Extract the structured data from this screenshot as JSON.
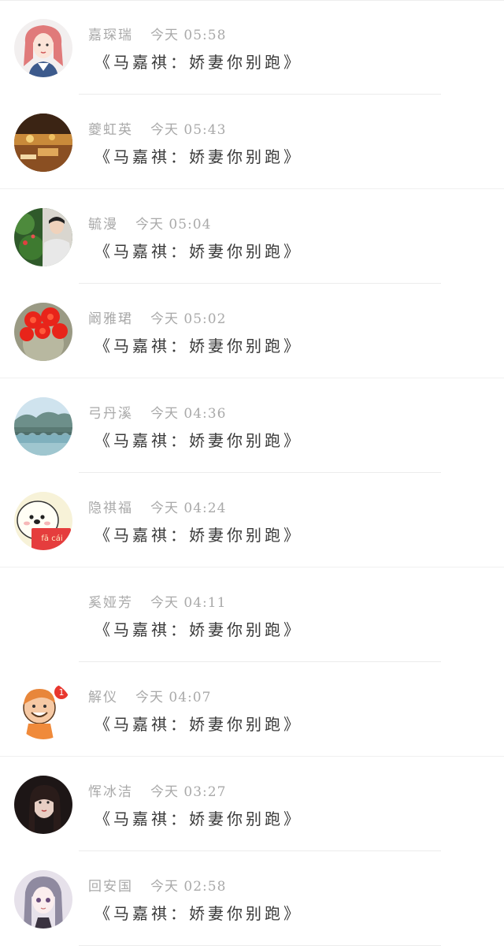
{
  "messages": [
    {
      "name": "嘉琛瑞",
      "time": "今天 05:58",
      "text": "《马嘉祺：娇妻你别跑》",
      "avatar": "girl-red-hair-avatar"
    },
    {
      "name": "夔虹英",
      "time": "今天 05:43",
      "text": "《马嘉祺：娇妻你别跑》",
      "avatar": "warm-street-photo-avatar"
    },
    {
      "name": "毓漫",
      "time": "今天 05:04",
      "text": "《马嘉祺：娇妻你别跑》",
      "avatar": "man-in-garden-avatar"
    },
    {
      "name": "阚雅珺",
      "time": "今天 05:02",
      "text": "《马嘉祺：娇妻你别跑》",
      "avatar": "red-cactus-flower-avatar"
    },
    {
      "name": "弓丹溪",
      "time": "今天 04:36",
      "text": "《马嘉祺：娇妻你别跑》",
      "avatar": "bridge-lake-avatar"
    },
    {
      "name": "隐祺福",
      "time": "今天 04:24",
      "text": "《马嘉祺：娇妻你别跑》",
      "avatar": "cartoon-seal-facai-avatar",
      "avatar_text": "fā cái"
    },
    {
      "name": "奚娅芳",
      "time": "今天 04:11",
      "text": "《马嘉祺：娇妻你别跑》",
      "avatar": "blank-avatar"
    },
    {
      "name": "解仪",
      "time": "今天 04:07",
      "text": "《马嘉祺：娇妻你别跑》",
      "avatar": "cartoon-boy-avatar",
      "avatar_text": "1"
    },
    {
      "name": "恽冰洁",
      "time": "今天 03:27",
      "text": "《马嘉祺：娇妻你别跑》",
      "avatar": "dark-hair-girl-avatar"
    },
    {
      "name": "回安国",
      "time": "今天 02:58",
      "text": "《马嘉祺：娇妻你别跑》",
      "avatar": "anime-girl-avatar"
    }
  ],
  "colors": {
    "name_time": "#a9a9a9",
    "message": "#3a3a3a",
    "divider": "#ececec"
  }
}
